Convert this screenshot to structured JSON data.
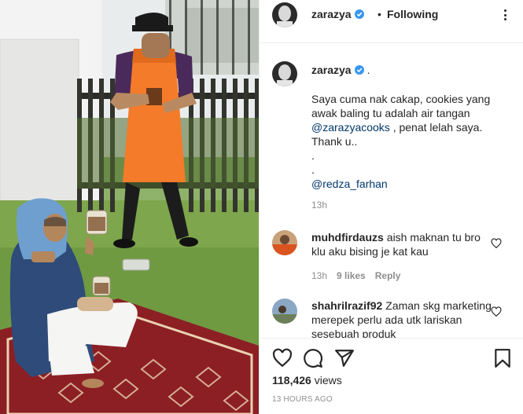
{
  "header": {
    "username": "zarazya",
    "separator": "•",
    "follow_status": "Following"
  },
  "caption": {
    "username": "zarazya",
    "suffix": ".",
    "lines": [
      "Saya cuma nak cakap, cookies yang",
      "awak baling tu adalah air tangan"
    ],
    "mention1": "@zarazyacooks",
    "after_mention1": " , penat lelah saya.",
    "line_thanks": "Thank u..",
    "dot1": ".",
    "dot2": ".",
    "mention2": "@redza_farhan",
    "time": "13h"
  },
  "comments": [
    {
      "username": "muhdfirdauzs",
      "text": "aish maknan tu bro klu aku bising je kat kau",
      "time": "13h",
      "likes": "9 likes",
      "reply": "Reply"
    },
    {
      "username": "shahrilrazif92",
      "text": "Zaman skg marketing merepek perlu ada utk lariskan sesebuah produk",
      "time": "",
      "likes": "",
      "reply": ""
    }
  ],
  "footer": {
    "views_count": "118,426",
    "views_label": "views",
    "posted": "13 HOURS AGO"
  },
  "colors": {
    "verified_blue": "#3897f0",
    "mention_blue": "#00376b",
    "secondary_text": "#8e8e8e",
    "apron_orange": "#f47b2a"
  },
  "icons": [
    "verified-badge-icon",
    "more-options-icon",
    "heart-icon",
    "comment-icon",
    "share-icon",
    "bookmark-icon"
  ]
}
